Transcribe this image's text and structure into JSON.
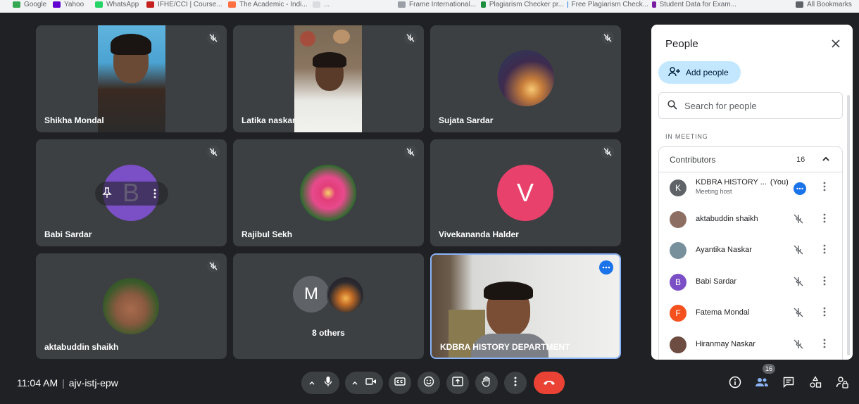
{
  "bookmarks_bar": {
    "items": [
      {
        "label": "Google",
        "color": "#34a853"
      },
      {
        "label": "Yahoo",
        "color": "#6001d2"
      },
      {
        "label": "WhatsApp",
        "color": "#25d366"
      },
      {
        "label": "IFHE/CCI | Course...",
        "color": "#c5221f"
      },
      {
        "label": "The Academic - Indi...",
        "color": "#ff7043"
      },
      {
        "label": "...",
        "color": "#dadce0"
      },
      {
        "label": "Frame International...",
        "color": "#9aa0a6"
      },
      {
        "label": "Plagiarism Checker pr...",
        "color": "#1e8e3e"
      },
      {
        "label": "Free Plagiarism Check...",
        "color": "#1a73e8"
      },
      {
        "label": "Student Data for Exam...",
        "color": "#7b1fa2"
      },
      {
        "label": "All Bookmarks",
        "color": "#5f6368"
      }
    ]
  },
  "tiles": [
    {
      "name": "Shikha Mondal"
    },
    {
      "name": "Latika naskar"
    },
    {
      "name": "Sujata Sardar"
    },
    {
      "name": "Babi Sardar",
      "initial": "B"
    },
    {
      "name": "Rajibul Sekh"
    },
    {
      "name": "Vivekananda Halder",
      "initial": "V"
    },
    {
      "name": "aktabuddin shaikh"
    },
    {
      "name": "8 others",
      "initial": "M"
    },
    {
      "name": "KDBRA HISTORY DEPARTMENT"
    }
  ],
  "people_panel": {
    "title": "People",
    "add_people_label": "Add people",
    "search_placeholder": "Search for people",
    "section_label": "IN MEETING",
    "group_label": "Contributors",
    "group_count": "16",
    "participants": [
      {
        "name": "KDBRA HISTORY ...",
        "you": "(You)",
        "role": "Meeting host",
        "initial": "K",
        "color": "#5f6368"
      },
      {
        "name": "aktabuddin shaikh",
        "initial": "",
        "color": "#8d6e63"
      },
      {
        "name": "Ayantika Naskar",
        "initial": "",
        "color": "#78909c"
      },
      {
        "name": "Babi Sardar",
        "initial": "B",
        "color": "#7b4fc5"
      },
      {
        "name": "Fatema Mondal",
        "initial": "F",
        "color": "#f4511e"
      },
      {
        "name": "Hiranmay Naskar",
        "initial": "",
        "color": "#6d4c41"
      }
    ]
  },
  "footer": {
    "time": "11:04 AM",
    "separator": "|",
    "meeting_code": "ajv-istj-epw",
    "people_count": "16"
  },
  "colors": {
    "background": "#202124",
    "tile": "#3c4043",
    "accent": "#8ab4f8",
    "end_call": "#ea4335",
    "host_more": "#1a73e8"
  }
}
